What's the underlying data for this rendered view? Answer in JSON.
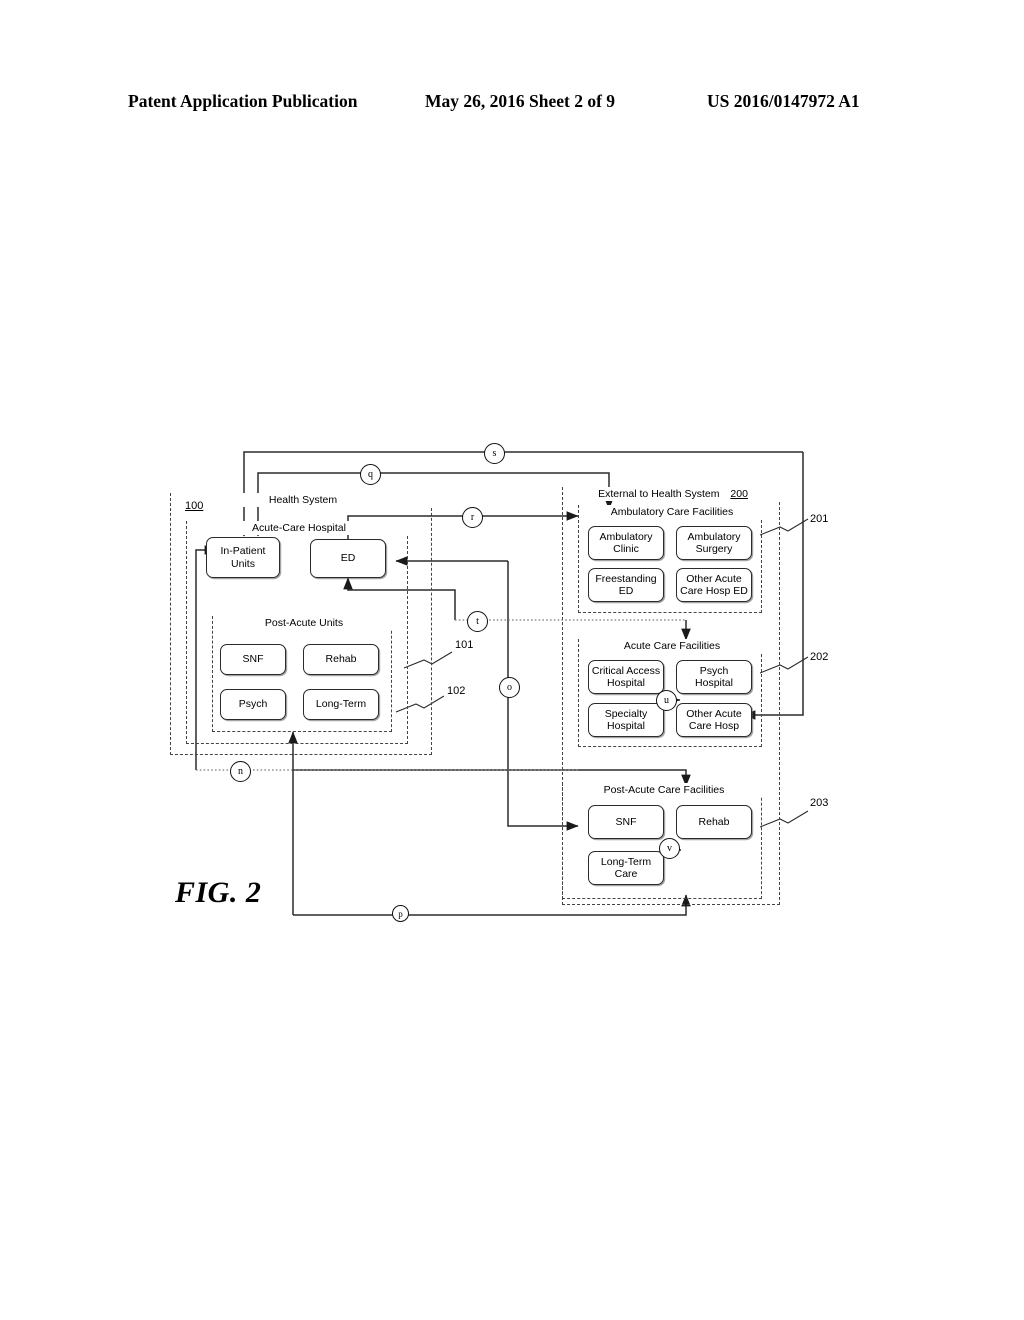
{
  "header": {
    "left": "Patent Application Publication",
    "middle": "May 26, 2016  Sheet 2 of 9",
    "right": "US 2016/0147972 A1"
  },
  "figure": {
    "label": "FIG. 2"
  },
  "groups": {
    "health_system": {
      "title": "Health System",
      "ref": "100"
    },
    "acute_care_hospital": {
      "title": "Acute-Care Hospital",
      "ref": "101"
    },
    "post_acute_units": {
      "title": "Post-Acute Units",
      "ref": "102"
    },
    "external": {
      "title": "External to Health System",
      "ref": "200"
    },
    "ambulatory": {
      "title": "Ambulatory Care Facilities",
      "ref": "201"
    },
    "acute_facilities": {
      "title": "Acute Care Facilities",
      "ref": "202"
    },
    "post_acute_facilities": {
      "title": "Post-Acute Care Facilities",
      "ref": "203"
    }
  },
  "nodes": {
    "in_patient_units": "In-Patient\nUnits",
    "ed": "ED",
    "pau_snf": "SNF",
    "pau_rehab": "Rehab",
    "pau_psych": "Psych",
    "pau_long_term": "Long-Term",
    "amb_clinic": "Ambulatory\nClinic",
    "amb_surgery": "Ambulatory\nSurgery",
    "amb_freestanding_ed": "Freestanding\nED",
    "amb_other_acute_ed": "Other Acute\nCare Hosp ED",
    "acf_critical_access": "Critical Access\nHospital",
    "acf_psych_hospital": "Psych\nHospital",
    "acf_specialty": "Specialty\nHospital",
    "acf_other_acute": "Other Acute\nCare Hosp",
    "pacf_snf": "SNF",
    "pacf_rehab": "Rehab",
    "pacf_long_term_care": "Long-Term\nCare"
  },
  "connectors": [
    {
      "id": "n",
      "label": "n"
    },
    {
      "id": "o",
      "label": "o"
    },
    {
      "id": "p",
      "label": "p"
    },
    {
      "id": "q",
      "label": "q"
    },
    {
      "id": "r",
      "label": "r"
    },
    {
      "id": "s",
      "label": "s"
    },
    {
      "id": "t",
      "label": "t"
    },
    {
      "id": "u",
      "label": "u"
    },
    {
      "id": "v",
      "label": "v"
    }
  ]
}
